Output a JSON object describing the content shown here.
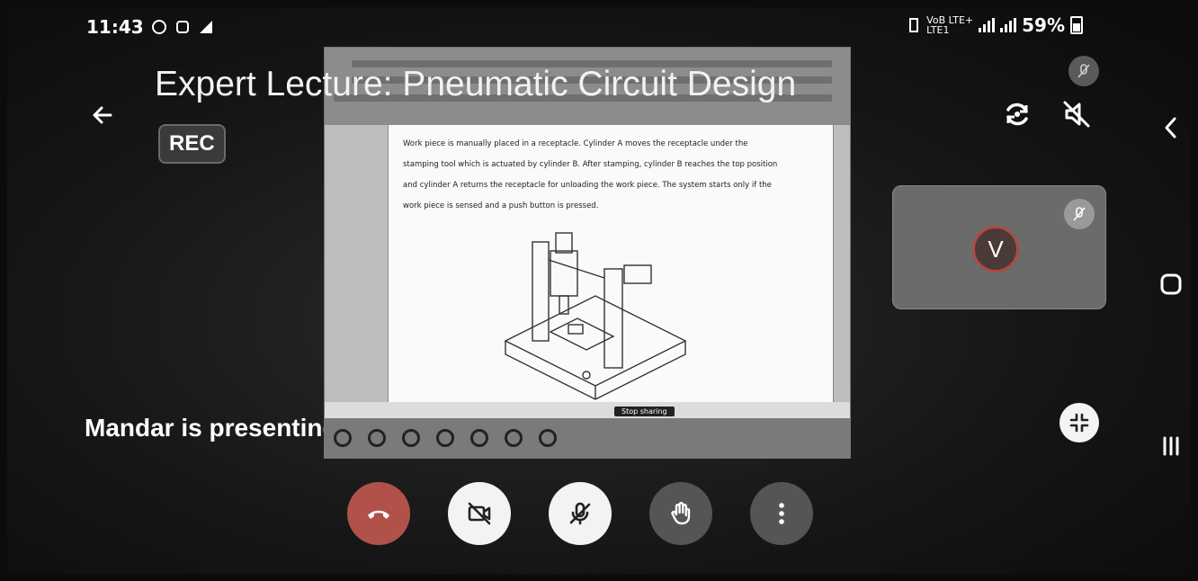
{
  "status_bar": {
    "time": "11:43",
    "network_label_top": "VoB LTE+",
    "network_label_bottom": "LTE1 ",
    "battery": "59%"
  },
  "meeting": {
    "title": "Expert Lecture: Pneumatic Circuit Design",
    "rec_label": "REC",
    "presenting_text": "Mandar is presenting"
  },
  "shared_screen": {
    "paragraph": "Work piece is manually placed in a receptacle. Cylinder A moves the receptacle under the stamping tool which is actuated by cylinder B. After stamping, cylinder B reaches the top position and cylinder A returns the receptacle for unloading the work piece. The system starts only if the work piece is sensed and a push button is pressed.",
    "stop_sharing_label": "Stop sharing"
  },
  "participant": {
    "initial": "V"
  },
  "icons": {
    "back": "arrow-left-icon",
    "flip_camera": "flip-camera-icon",
    "speaker_off": "speaker-off-icon",
    "mic_off": "mic-off-icon",
    "layout": "layout-collapse-icon",
    "end_call": "phone-hangup-icon",
    "camera_off": "camera-off-icon",
    "raise_hand": "hand-icon",
    "more": "more-vertical-icon"
  },
  "colors": {
    "end_call": "#b0524a",
    "avatar_ring": "#b04a40"
  }
}
